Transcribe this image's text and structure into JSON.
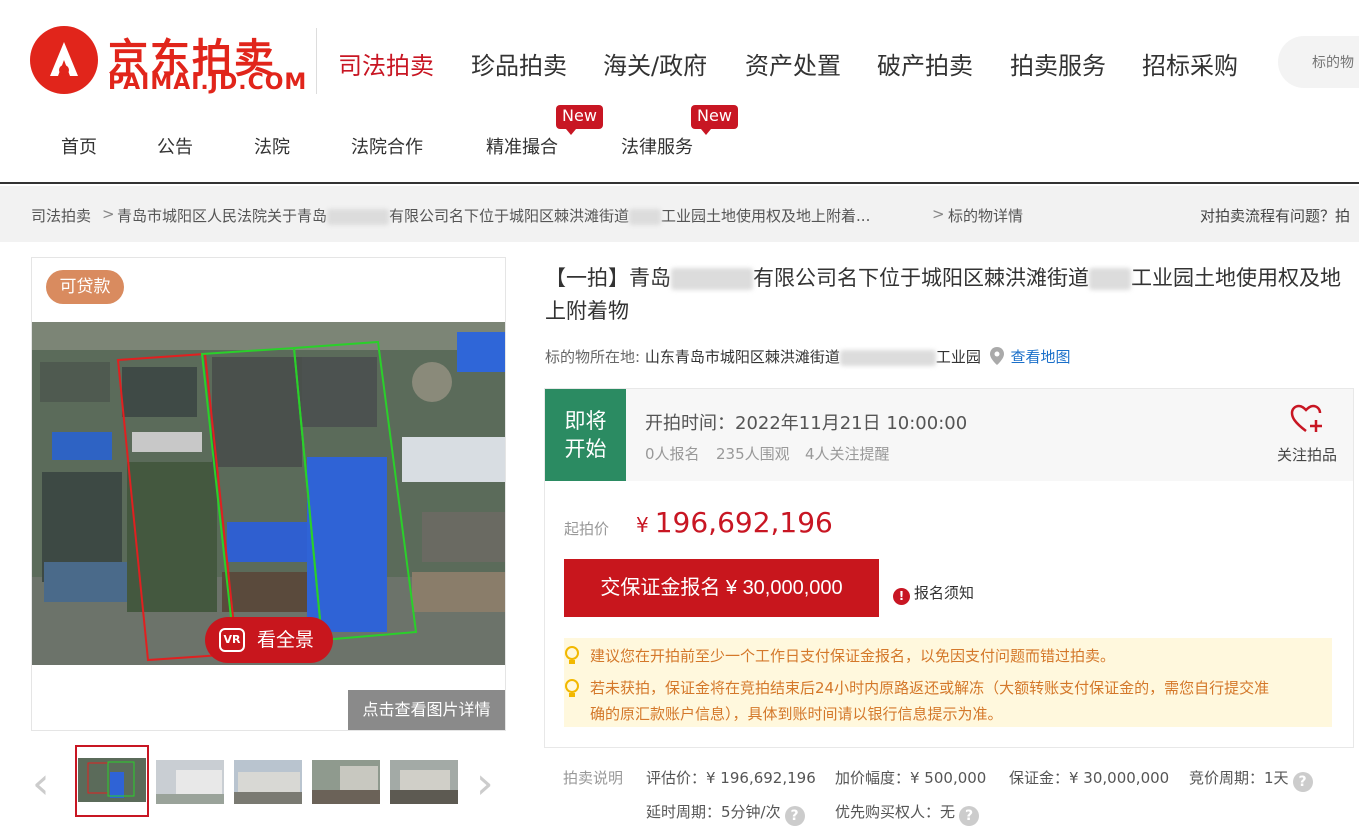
{
  "header": {
    "logo_cn": "京东拍卖",
    "logo_en": "PAIMAI.JD.COM",
    "main_nav": [
      "司法拍卖",
      "珍品拍卖",
      "海关/政府",
      "资产处置",
      "破产拍卖",
      "拍卖服务",
      "招标采购"
    ],
    "search_placeholder": "标的物",
    "sub_nav": [
      "首页",
      "公告",
      "法院",
      "法院合作",
      "精准撮合",
      "法律服务"
    ],
    "new_badge": "New"
  },
  "breadcrumb": {
    "items": [
      "司法拍卖",
      "青岛市城阳区人民法院关于青岛",
      "有限公司名下位于城阳区棘洪滩街道",
      "工业园土地使用权及地上附着...",
      "标的物详情"
    ],
    "help": "对拍卖流程有问题？拍"
  },
  "gallery": {
    "loan_badge": "可贷款",
    "pano_icon": "VR",
    "pano_label": "看全景",
    "detail_link": "点击查看图片详情",
    "prev": "‹",
    "next": "›"
  },
  "item": {
    "title_a": "【一拍】青岛",
    "title_b": "有限公司名下位于城阳区棘洪滩街道",
    "title_c": "工业园土地使用权及地上附着物",
    "location_label": "标的物所在地:",
    "location_a": "山东青岛市城阳区棘洪滩街道",
    "location_b": "工业园",
    "map_link": "查看地图"
  },
  "bid": {
    "status_line1": "即将",
    "status_line2": "开始",
    "start_time": "开拍时间：2022年11月21日 10:00:00",
    "signups": "0人报名",
    "views": "235人围观",
    "followers": "4人关注提醒",
    "follow_label": "关注拍品",
    "start_price_label": "起拍价",
    "currency": "¥",
    "start_price": "196,692,196",
    "deposit_button": "交保证金报名 ¥ 30,000,000",
    "notice_icon": "!",
    "notice_link": "报名须知",
    "tip1": "建议您在开拍前至少一个工作日支付保证金报名，以免因支付问题而错过拍卖。",
    "tip2_line1": "若未获拍，保证金将在竞拍结束后24小时内原路返还或解冻（大额转账支付保证金的，需您自行提交准",
    "tip2_line2": "确的原汇款账户信息），具体到账时间请以银行信息提示为准。"
  },
  "auction_info": {
    "label": "拍卖说明",
    "appraisal": "评估价：¥ 196,692,196",
    "increment": "加价幅度：¥ 500,000",
    "deposit": "保证金：¥ 30,000,000",
    "cycle": "竞价周期：1天",
    "delay": "延时周期：5分钟/次",
    "priority": "优先购买权人：无",
    "help_icon": "?"
  }
}
